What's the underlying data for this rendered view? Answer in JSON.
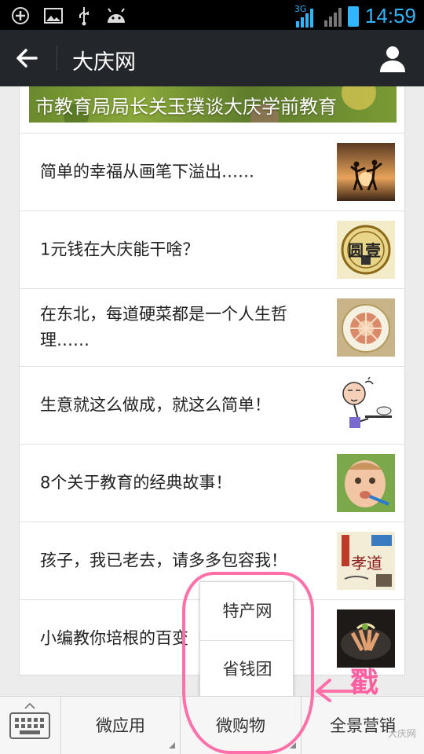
{
  "status_bar": {
    "network": "3G",
    "time": "14:59",
    "icons": [
      "add-circle-icon",
      "image-icon",
      "usb-icon",
      "android-icon",
      "signal-icon",
      "battery-icon"
    ]
  },
  "titlebar": {
    "title": "大庆网",
    "back_icon": "back-arrow-icon",
    "profile_icon": "person-icon"
  },
  "article_list": {
    "banner_caption": "市教育局局长关玉璞谈大庆学前教育",
    "items": [
      {
        "title": "简单的幸福从画笔下溢出……",
        "thumb": "sunset-silhouette"
      },
      {
        "title": "1元钱在大庆能干啥？",
        "thumb": "coin",
        "thumb_text": "圆壹"
      },
      {
        "title": "在东北，每道硬菜都是一个人生哲理……",
        "thumb": "dish"
      },
      {
        "title": "生意就这么做成，就这么简单！",
        "thumb": "cartoon"
      },
      {
        "title": "8个关于教育的经典故事！",
        "thumb": "baby"
      },
      {
        "title": "孩子，我已老去，请多多包容我！",
        "thumb": "filial",
        "thumb_text": "孝道"
      },
      {
        "title": "小编教你培根的百变",
        "thumb": "bacon"
      }
    ]
  },
  "bottom_menu": {
    "keyboard_icon": "keyboard-icon",
    "items": [
      "微应用",
      "微购物",
      "全景营销"
    ]
  },
  "popup_menu": {
    "items": [
      "特产网",
      "省钱团"
    ]
  },
  "annotation": {
    "text": "戳"
  },
  "watermark": "大庆网",
  "colors": {
    "titlebar": "#23272b",
    "status_accent": "#2fb6ff",
    "annotation": "#ff6fa8"
  }
}
